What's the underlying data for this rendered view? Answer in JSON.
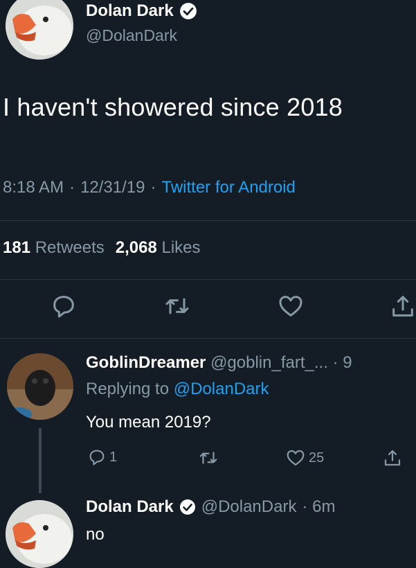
{
  "main_tweet": {
    "display_name": "Dolan Dark",
    "handle": "@DolanDark",
    "text": "I haven't showered since 2018",
    "time": "8:18 AM",
    "dot1": "·",
    "date": "12/31/19",
    "dot2": "·",
    "source": "Twitter for Android",
    "retweets_count": "181",
    "retweets_label": "Retweets",
    "likes_count": "2,068",
    "likes_label": "Likes"
  },
  "reply": {
    "display_name": "GoblinDreamer",
    "handle": "@goblin_fart_...",
    "time_partial": "· 9",
    "replying_prefix": "Replying to",
    "replying_handle": "@DolanDark",
    "text": "You mean 2019?",
    "reply_count": "1",
    "like_count": "25"
  },
  "last_reply": {
    "display_name": "Dolan Dark",
    "handle": "@DolanDark",
    "time": "· 6m",
    "text": "no"
  },
  "colors": {
    "background": "#141d26",
    "link": "#1da1f2",
    "muted": "#8899a6"
  },
  "icons": [
    "verified-badge-icon",
    "reply-icon",
    "retweet-icon",
    "like-icon",
    "share-icon"
  ]
}
